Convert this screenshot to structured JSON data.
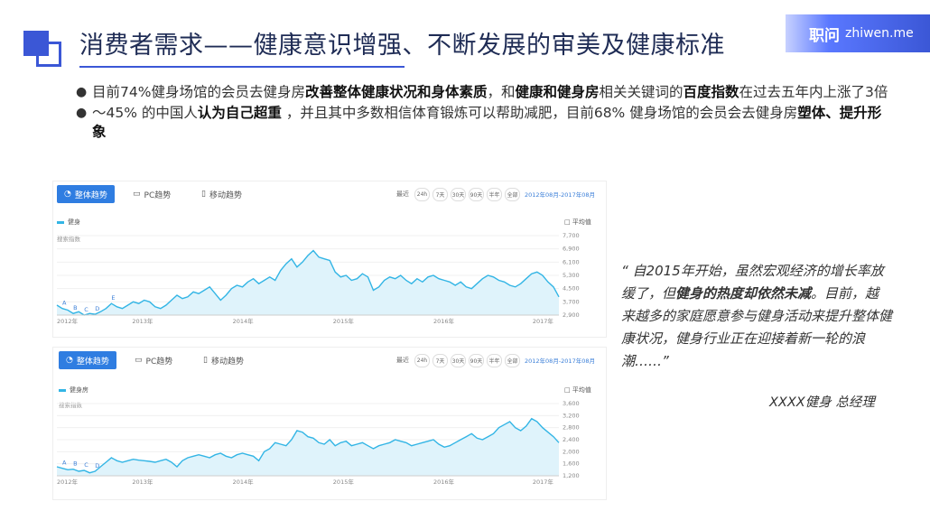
{
  "slide": {
    "title": "消费者需求——健康意识增强、不断发展的审美及健康标准",
    "brand_cn": "职问",
    "brand_en": "zhiwen.me"
  },
  "bullets": [
    {
      "pre": "目前74%健身场馆的会员去健身房",
      "b1": "改善整体健康状况和身体素质",
      "mid1": "，和",
      "b2": "健康和健身房",
      "mid2": "相关关键词的",
      "b3": "百度指数",
      "post": "在过去五年内上涨了3倍"
    },
    {
      "pre": "～45% 的中国人",
      "b1": "认为自己超重",
      "mid1": " ，并且其中多数相信体育锻炼可以帮助减肥，目前68% 健身场馆的会员会去健身房",
      "b2": "塑体、提升形象",
      "mid2": "",
      "b3": "",
      "post": ""
    }
  ],
  "quote": {
    "p1": "“ 自2015年开始，虽然宏观经济的增长率放缓了，但",
    "bold": "健身的热度却依然未减",
    "p2": "。目前，越来越多的家庭愿意参与健身活动来提升整体健康状况，健身行业正在迎接着新一轮的浪潮……”",
    "signature": "XXXX健身  总经理"
  },
  "charts": [
    {
      "tabs": [
        "整体趋势",
        "PC趋势",
        "移动趋势"
      ],
      "range_label": "最近",
      "range_buttons": [
        "24h",
        "7天",
        "30天",
        "90天",
        "半年",
        "全部"
      ],
      "date_range": "2012年08月-2017年08月",
      "legend": "健身",
      "avg_label": "□ 平均值",
      "y_label": "搜索指数",
      "y_ticks": [
        "7,700",
        "6,900",
        "6,100",
        "5,300",
        "4,500",
        "3,700",
        "2,900"
      ],
      "x_ticks": [
        "2012年",
        "2013年",
        "2014年",
        "2015年",
        "2016年",
        "2017年"
      ],
      "markers": [
        "A",
        "B",
        "C",
        "D",
        "E"
      ]
    },
    {
      "tabs": [
        "整体趋势",
        "PC趋势",
        "移动趋势"
      ],
      "range_label": "最近",
      "range_buttons": [
        "24h",
        "7天",
        "30天",
        "90天",
        "半年",
        "全部"
      ],
      "date_range": "2012年08月-2017年08月",
      "legend": "健身房",
      "avg_label": "□ 平均值",
      "y_label": "搜索指数",
      "y_ticks": [
        "3,600",
        "3,200",
        "2,800",
        "2,400",
        "2,000",
        "1,600",
        "1,200"
      ],
      "x_ticks": [
        "2012年",
        "2013年",
        "2014年",
        "2015年",
        "2016年",
        "2017年"
      ],
      "markers": [
        "A",
        "B",
        "C",
        "D"
      ]
    }
  ],
  "chart_data": [
    {
      "type": "area",
      "series": [
        {
          "name": "健身",
          "values": [
            3500,
            3300,
            3200,
            3000,
            3100,
            2900,
            3000,
            2950,
            3100,
            3300,
            3600,
            3400,
            3300,
            3500,
            3700,
            3600,
            3800,
            3700,
            3400,
            3300,
            3500,
            3800,
            4100,
            3900,
            4000,
            4300,
            4200,
            4400,
            4600,
            4200,
            3800,
            4100,
            4500,
            4700,
            4600,
            4900,
            5100,
            4800,
            5000,
            5200,
            5000,
            5600,
            6000,
            6300,
            5800,
            6100,
            6500,
            6800,
            6400,
            6300,
            6200,
            5500,
            5200,
            5300,
            5000,
            5100,
            5400,
            5200,
            4400,
            4600,
            5000,
            5200,
            5100,
            5300,
            5000,
            4800,
            5100,
            4900,
            5200,
            5300,
            5100,
            5000,
            4900,
            4700,
            4900,
            4600,
            4500,
            4800,
            5100,
            5300,
            5200,
            5000,
            4900,
            4700,
            4600,
            4800,
            5100,
            5400,
            5500,
            5300,
            4900,
            4600,
            4000
          ]
        }
      ],
      "ylim": [
        2900,
        7700
      ]
    },
    {
      "type": "area",
      "series": [
        {
          "name": "健身房",
          "values": [
            1500,
            1450,
            1400,
            1420,
            1350,
            1380,
            1300,
            1350,
            1500,
            1650,
            1800,
            1700,
            1650,
            1700,
            1750,
            1720,
            1700,
            1680,
            1650,
            1700,
            1750,
            1650,
            1500,
            1700,
            1800,
            1850,
            1900,
            1850,
            1800,
            1900,
            1950,
            1850,
            1800,
            1900,
            1950,
            1900,
            1850,
            1700,
            2000,
            2100,
            2300,
            2250,
            2200,
            2400,
            2700,
            2650,
            2500,
            2450,
            2300,
            2250,
            2400,
            2200,
            2300,
            2350,
            2200,
            2250,
            2300,
            2200,
            2100,
            2200,
            2250,
            2300,
            2400,
            2350,
            2300,
            2200,
            2250,
            2300,
            2350,
            2400,
            2250,
            2150,
            2200,
            2300,
            2400,
            2500,
            2600,
            2450,
            2400,
            2500,
            2600,
            2800,
            2900,
            3000,
            2800,
            2700,
            2850,
            3100,
            3000,
            2800,
            2650,
            2500,
            2300
          ]
        }
      ],
      "ylim": [
        1200,
        3600
      ]
    }
  ]
}
